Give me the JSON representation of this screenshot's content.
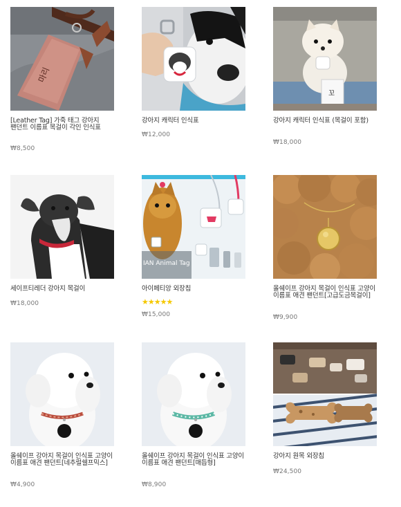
{
  "colors": {
    "accent_star": "#f5c800",
    "price_text": "#777777",
    "title_text": "#333333"
  },
  "products": [
    {
      "image": "leather-tag-photo",
      "title": "[Leather Tag] 가죽 태그 강아지 팬던트 이름표 목걸이 각인 인식표",
      "price": "₩8,500"
    },
    {
      "image": "character-tag-bulldog-photo",
      "title": "강아지 캐릭터 인식표",
      "price": "₩12,000"
    },
    {
      "image": "character-tag-pomeranian-photo",
      "title": "강아지 캐릭터 인식표 (목걸이 포함)",
      "price": "₩18,000"
    },
    {
      "image": "whippet-collar-photo",
      "title": "세이프티레더 강아지 목걸이",
      "price": "₩18,000"
    },
    {
      "image": "idphotag-yorkie-photo",
      "image_caption": "IAN Animal Tag",
      "title": "아이페티앙 외장칩",
      "rating": 5,
      "stars_text": "★★★★★",
      "price": "₩15,000"
    },
    {
      "image": "gold-tag-poodle-photo",
      "title": "올쉐이프 강아지 목걸이 인식표 고양이 이름표 애견 팬던트[고급도금목걸이]",
      "price": "₩9,900"
    },
    {
      "image": "white-dog-collar-red-photo",
      "title": "올쉐이프 강아지 목걸이 인식표 고양이 이름표 애견 팬던트[네추럴쉘프믹스]",
      "price": "₩4,900"
    },
    {
      "image": "white-dog-collar-mint-photo",
      "title": "올쉐이프 강아지 목걸이 인식표 고양이 이름표 애견 팬던트[매듭형]",
      "price": "₩8,900"
    },
    {
      "image": "wooden-bone-chip-photo",
      "title": "강아지 원목 외장칩",
      "price": "₩24,500"
    }
  ]
}
